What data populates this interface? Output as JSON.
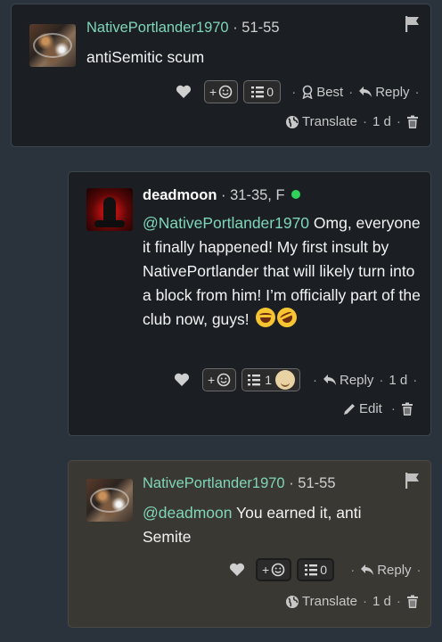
{
  "comments": [
    {
      "username": "NativePortlander1970",
      "age_range": "51-55",
      "text": "antiSemitic scum",
      "heart_label": "",
      "react_label": "+",
      "list_count": "0",
      "best_label": "Best",
      "reply_label": "Reply",
      "translate_label": "Translate",
      "time": "1 d"
    },
    {
      "username": "deadmoon",
      "age_range": "31-35, F",
      "mention": "@NativePortlander1970",
      "text": " Omg, everyone it finally happened! My first insult by NativePortlander that will likely turn into a block from him! I’m officially part of the club now, guys!",
      "react_label": "+",
      "list_count": "1",
      "reply_label": "Reply",
      "time": "1 d",
      "edit_label": "Edit"
    },
    {
      "username": "NativePortlander1970",
      "age_range": "51-55",
      "mention": "@deadmoon",
      "text": " You earned it, anti Semite",
      "react_label": "+",
      "list_count": "0",
      "reply_label": "Reply",
      "translate_label": "Translate",
      "time": "1 d"
    }
  ],
  "separators": {
    "dot": "·"
  },
  "colors": {
    "page_bg": "#2a323b",
    "card_bg": "#1b1f23",
    "highlight_bg": "#3a3833",
    "username": "#7fd6b8",
    "online": "#2fd35a"
  },
  "icons": [
    "flag-icon",
    "heart-icon",
    "smiley-icon",
    "list-icon",
    "award-icon",
    "reply-arrow-icon",
    "globe-icon",
    "trash-icon",
    "pencil-icon"
  ]
}
